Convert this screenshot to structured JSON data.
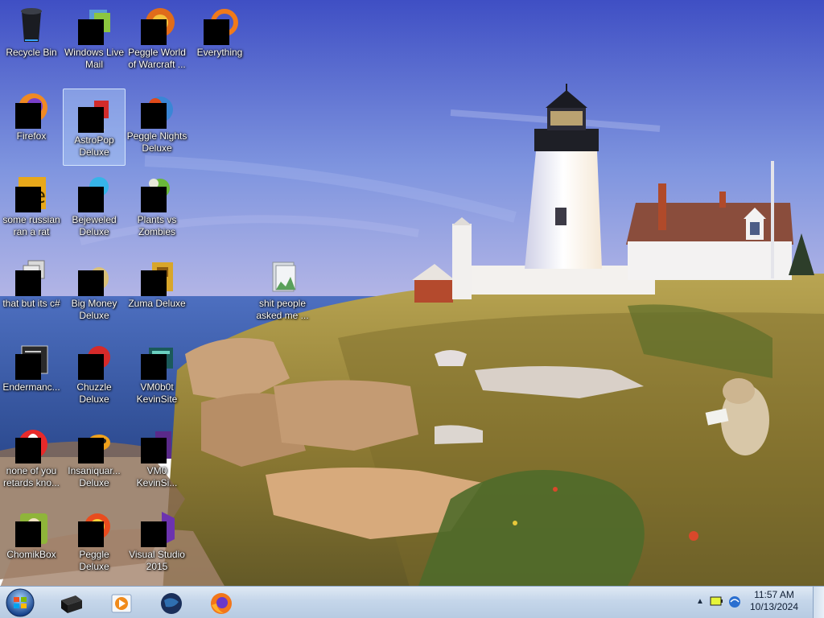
{
  "desktop": {
    "icons": [
      {
        "id": "recycle-bin",
        "label": "Recycle Bin",
        "icon": "recycle-bin-icon",
        "masked": false
      },
      {
        "id": "firefox",
        "label": "Firefox",
        "icon": "firefox-icon",
        "masked": true
      },
      {
        "id": "russian-rat",
        "label": "some russian ran a rat",
        "icon": "exe-file-icon",
        "masked": true
      },
      {
        "id": "csharp",
        "label": "that but its c#",
        "icon": "stacked-windows-icon",
        "masked": true
      },
      {
        "id": "endermanch",
        "label": "Endermanc...",
        "icon": "console-window-icon",
        "masked": true
      },
      {
        "id": "none-of-you",
        "label": "none of you retards kno...",
        "icon": "opera-browser-icon",
        "masked": true
      },
      {
        "id": "chomikbox",
        "label": "ChomikBox",
        "icon": "hamster-box-icon",
        "masked": true
      },
      {
        "id": "live-mail",
        "label": "Windows Live Mail",
        "icon": "mail-envelopes-icon",
        "masked": true
      },
      {
        "id": "astropop",
        "label": "AstroPop Deluxe",
        "icon": "astropop-game-icon",
        "masked": true,
        "selected": true
      },
      {
        "id": "bejeweled",
        "label": "Bejeweled Deluxe",
        "icon": "gem-game-icon",
        "masked": true
      },
      {
        "id": "big-money",
        "label": "Big Money Deluxe",
        "icon": "money-bag-game-icon",
        "masked": true
      },
      {
        "id": "chuzzle",
        "label": "Chuzzle Deluxe",
        "icon": "chuzzle-game-icon",
        "masked": true
      },
      {
        "id": "insaniquarium",
        "label": "Insaniquar... Deluxe",
        "icon": "fish-game-icon",
        "masked": true
      },
      {
        "id": "peggle-deluxe",
        "label": "Peggle Deluxe",
        "icon": "peggle-game-icon",
        "masked": true
      },
      {
        "id": "peggle-wow",
        "label": "Peggle World of Warcraft ...",
        "icon": "peggle-game-icon",
        "masked": true
      },
      {
        "id": "peggle-nights",
        "label": "Peggle Nights Deluxe",
        "icon": "peggle-nights-icon",
        "masked": true
      },
      {
        "id": "pvz",
        "label": "Plants vs Zombies",
        "icon": "plant-game-icon",
        "masked": true
      },
      {
        "id": "zuma",
        "label": "Zuma Deluxe",
        "icon": "zuma-game-icon",
        "masked": true
      },
      {
        "id": "vm0b0t",
        "label": "VM0b0t KevinSite",
        "icon": "terminal-icon",
        "masked": true
      },
      {
        "id": "vm0-kevin",
        "label": "VM0 KevinSi...",
        "icon": "purple-app-icon",
        "masked": true
      },
      {
        "id": "visual-studio",
        "label": "Visual Studio 2015",
        "icon": "visual-studio-icon",
        "masked": true
      },
      {
        "id": "everything",
        "label": "Everything",
        "icon": "search-ring-icon",
        "masked": true
      },
      {
        "id": "shit-people",
        "label": "shit people asked me ...",
        "icon": "folder-icon",
        "masked": false
      }
    ]
  },
  "taskbar": {
    "start": "windows-start-orb-icon",
    "pinned": [
      {
        "id": "cmd",
        "icon": "command-prompt-icon"
      },
      {
        "id": "media",
        "icon": "media-player-icon"
      },
      {
        "id": "globe",
        "icon": "globe-icon"
      },
      {
        "id": "firefox",
        "icon": "firefox-icon"
      }
    ],
    "tray": {
      "time": "11:57 AM",
      "date": "10/13/2024",
      "chevron": "▲"
    }
  },
  "colors": {
    "sky_top": "#4a55c8",
    "sky_bottom": "#8fa6e6",
    "sea": "#3f60a8",
    "grass": "#9a8a3a",
    "taskbar": "#c5d6ea",
    "selection": "#bedcff"
  }
}
